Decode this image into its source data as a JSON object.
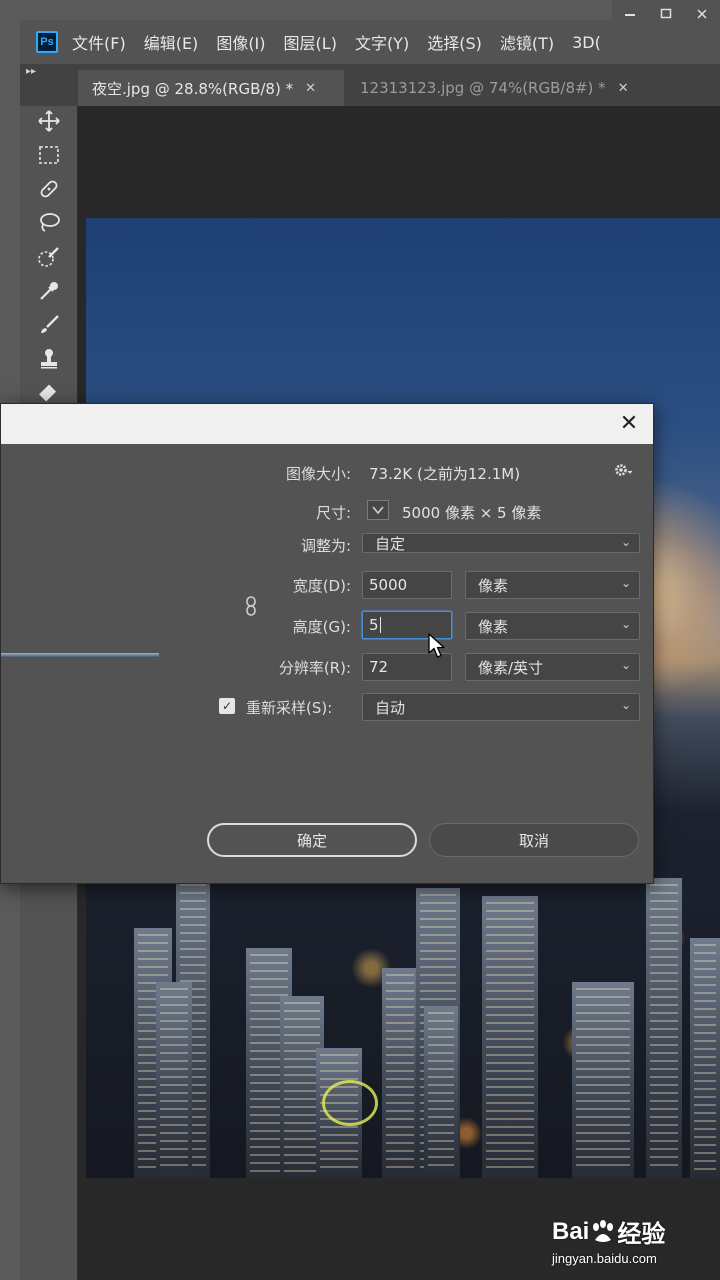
{
  "app": {
    "logo_text": "Ps",
    "menu": [
      "文件(F)",
      "编辑(E)",
      "图像(I)",
      "图层(L)",
      "文字(Y)",
      "选择(S)",
      "滤镜(T)",
      "3D("
    ]
  },
  "tabs": [
    {
      "label": "夜空.jpg @ 28.8%(RGB/8) *",
      "active": true
    },
    {
      "label": "12313123.jpg @ 74%(RGB/8#) *",
      "active": false
    }
  ],
  "tools": [
    "move-icon",
    "marquee-icon",
    "healing-icon",
    "lasso-icon",
    "quick-select-icon",
    "eyedropper-icon",
    "brush-icon",
    "stamp-icon",
    "eraser-icon"
  ],
  "dialog": {
    "image_size_label": "图像大小:",
    "image_size_value": "73.2K (之前为12.1M)",
    "dimensions_label": "尺寸:",
    "dimensions_value": "5000 像素 × 5 像素",
    "fit_to_label": "调整为:",
    "fit_to_value": "自定",
    "width_label": "宽度(D):",
    "width_value": "5000",
    "width_unit": "像素",
    "height_label": "高度(G):",
    "height_value": "5",
    "height_unit": "像素",
    "resolution_label": "分辨率(R):",
    "resolution_value": "72",
    "resolution_unit": "像素/英寸",
    "resample_label": "重新采样(S):",
    "resample_checked": true,
    "resample_value": "自动",
    "ok_label": "确定",
    "cancel_label": "取消"
  },
  "watermark": {
    "logo_text": "Bai",
    "logo_text_after": "经验",
    "url": "jingyan.baidu.com"
  },
  "colors": {
    "accent": "#31a8ff",
    "focus": "#4a90d9",
    "panel": "#535353",
    "canvas_bg": "#282828"
  }
}
